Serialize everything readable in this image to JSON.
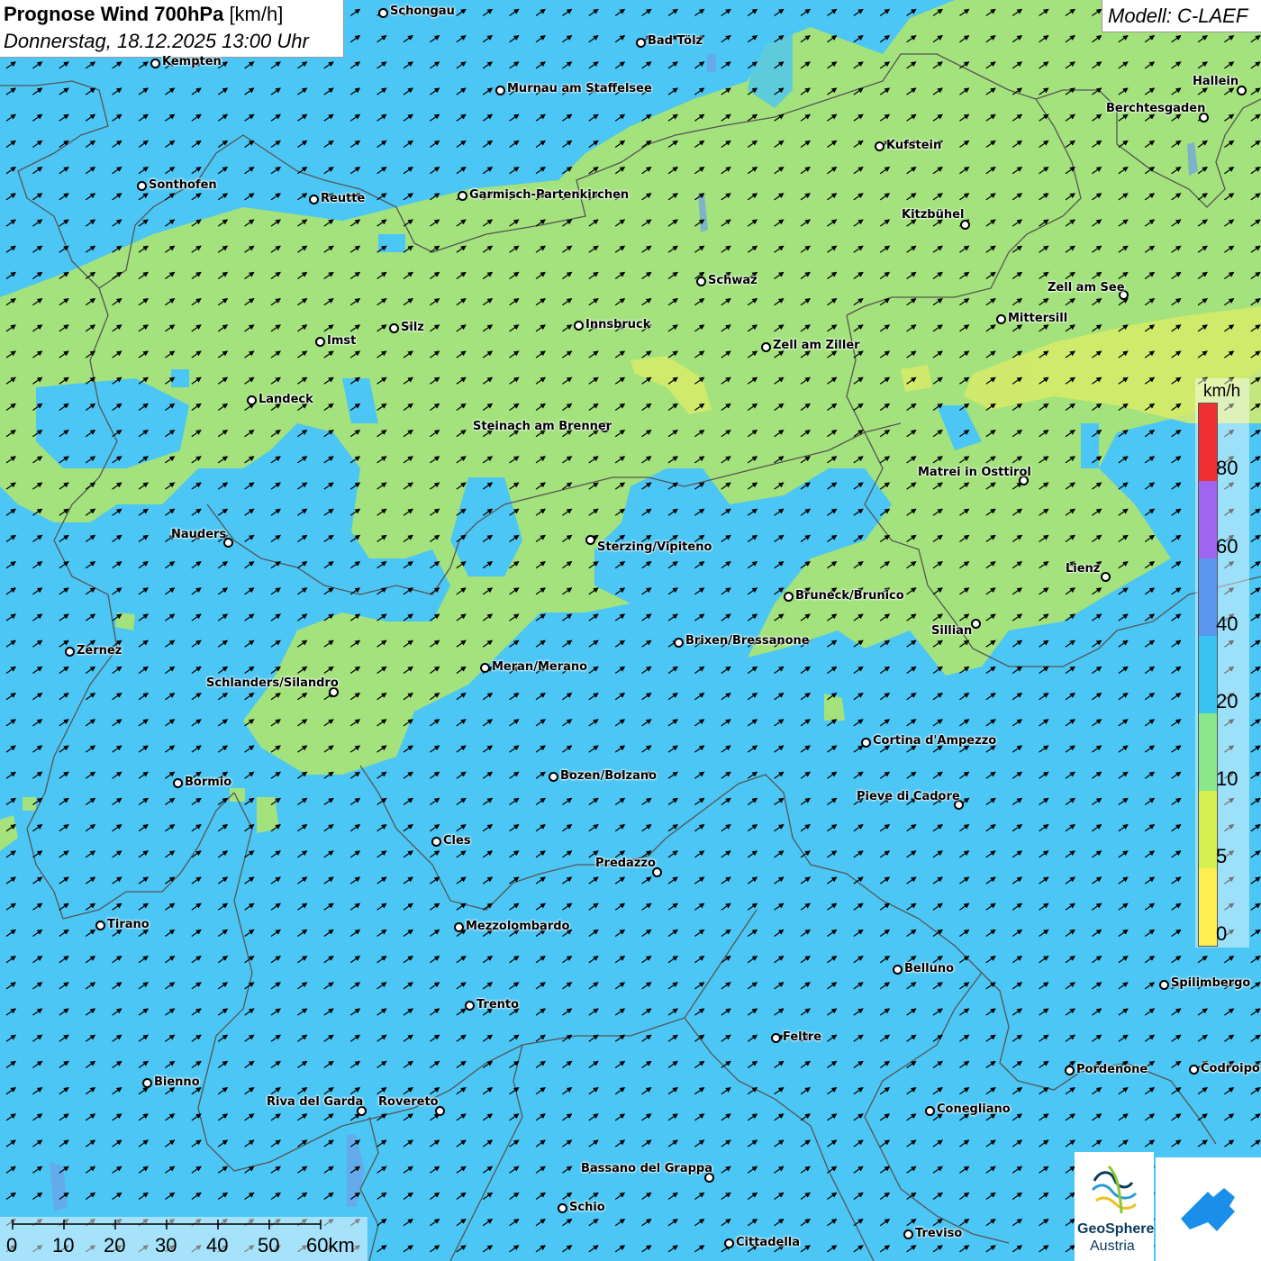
{
  "header": {
    "title_bold": "Prognose Wind 700hPa",
    "title_unit": "[km/h]",
    "datetime": "Donnerstag, 18.12.2025 13:00 Uhr",
    "model": "Modell: C-LAEF"
  },
  "legend": {
    "unit": "km/h",
    "labels": [
      "80",
      "60",
      "40",
      "20",
      "10",
      "5",
      "0"
    ],
    "colors": [
      "#f03030",
      "#a065f0",
      "#5c96f0",
      "#38c4f0",
      "#8ae88a",
      "#d6f050",
      "#fff050"
    ]
  },
  "scale": {
    "labels": [
      "0",
      "10",
      "20",
      "30",
      "40",
      "50",
      "60km"
    ]
  },
  "map": {
    "colors": {
      "sea_level_wind": "#4cc6f4",
      "calm_green": "#a3e27c",
      "light_yellow": "#d8eb6a",
      "border": "#555555",
      "lake": "#6fa0e8"
    },
    "cities": [
      {
        "name": "Schongau"
      },
      {
        "name": "Bad Tölz"
      },
      {
        "name": "Kempten"
      },
      {
        "name": "Murnau am Staffelsee"
      },
      {
        "name": "Hallein"
      },
      {
        "name": "Berchtesgaden"
      },
      {
        "name": "Kufstein"
      },
      {
        "name": "Sonthofen"
      },
      {
        "name": "Reutte"
      },
      {
        "name": "Garmisch-Partenkirchen"
      },
      {
        "name": "Kitzbühel"
      },
      {
        "name": "Schwaz"
      },
      {
        "name": "Zell am See"
      },
      {
        "name": "Mittersill"
      },
      {
        "name": "Innsbruck"
      },
      {
        "name": "Silz"
      },
      {
        "name": "Imst"
      },
      {
        "name": "Zell am Ziller"
      },
      {
        "name": "Landeck"
      },
      {
        "name": "Steinach am Brenner"
      },
      {
        "name": "Matrei in Osttirol"
      },
      {
        "name": "Nauders"
      },
      {
        "name": "Sterzing/Vipiteno"
      },
      {
        "name": "Lienz"
      },
      {
        "name": "Bruneck/Brunico"
      },
      {
        "name": "Sillian"
      },
      {
        "name": "Zernez"
      },
      {
        "name": "Brixen/Bressanone"
      },
      {
        "name": "Meran/Merano"
      },
      {
        "name": "Schlanders/Silandro"
      },
      {
        "name": "Cortina d'Ampezzo"
      },
      {
        "name": "Bormio"
      },
      {
        "name": "Bozen/Bolzano"
      },
      {
        "name": "Pieve di Cadore"
      },
      {
        "name": "Cles"
      },
      {
        "name": "Predazzo"
      },
      {
        "name": "Tirano"
      },
      {
        "name": "Mezzolombardo"
      },
      {
        "name": "Belluno"
      },
      {
        "name": "Spilimbergo"
      },
      {
        "name": "Trento"
      },
      {
        "name": "Feltre"
      },
      {
        "name": "Pordenone"
      },
      {
        "name": "Codroipo"
      },
      {
        "name": "Bienno"
      },
      {
        "name": "Riva del Garda"
      },
      {
        "name": "Rovereto"
      },
      {
        "name": "Conegliano"
      },
      {
        "name": "Bassano del Grappa"
      },
      {
        "name": "Schio"
      },
      {
        "name": "Treviso"
      },
      {
        "name": "Cittadella"
      }
    ]
  },
  "logo": {
    "name_line1": "GeoSphere",
    "name_line2": "Austria"
  }
}
